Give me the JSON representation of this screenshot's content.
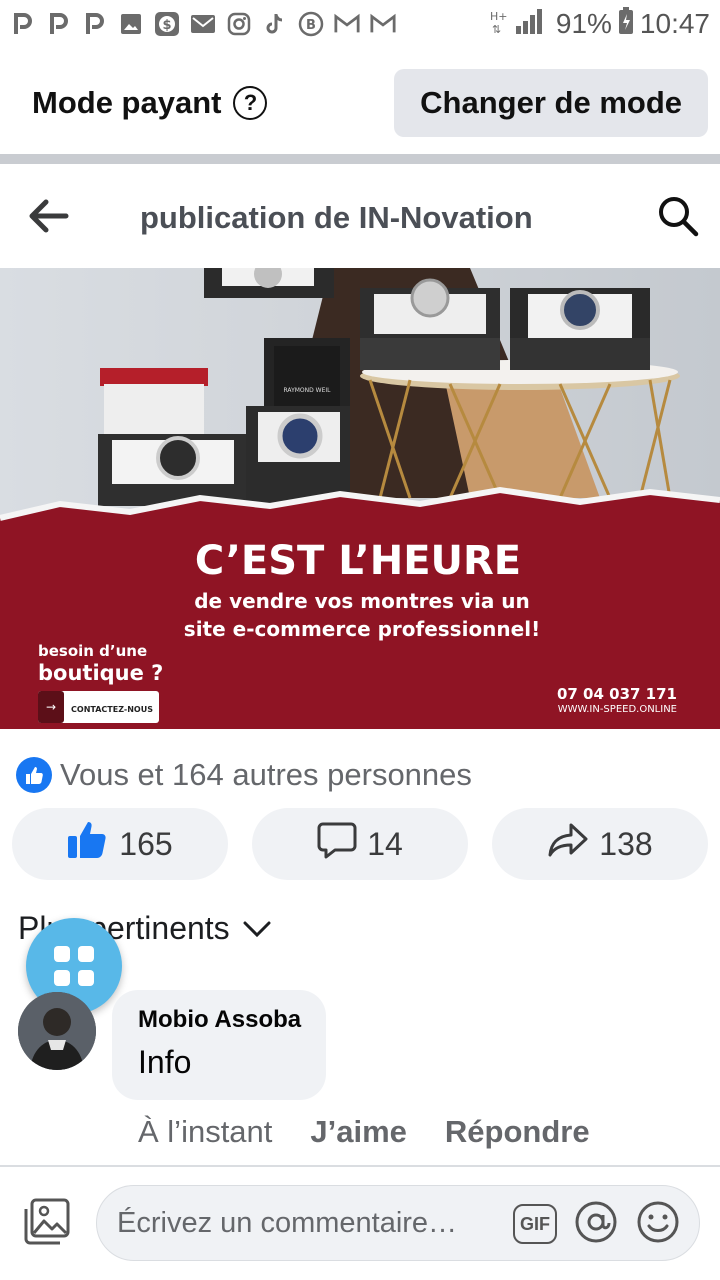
{
  "status_bar": {
    "left_icons": [
      "p-icon",
      "p-icon",
      "p-icon",
      "image-icon",
      "dollar-box-icon",
      "mail-icon",
      "instagram-icon",
      "tiktok-icon",
      "b-circle-icon",
      "gmail-icon",
      "gmail-icon"
    ],
    "battery": "91%",
    "time": "10:47"
  },
  "mode_bar": {
    "title": "Mode payant",
    "help_glyph": "?",
    "switch_button": "Changer de mode"
  },
  "header": {
    "title": "publication de IN-Novation"
  },
  "banner": {
    "watch_brand": "RAYMOND WEIL",
    "headline": "C’EST L’HEURE",
    "subline_1": "de vendre vos montres via un",
    "subline_2": "site e-commerce professionnel!",
    "aside_small": "besoin d’une",
    "aside_big": "boutique ?",
    "cta_arrow": "→",
    "cta": "CONTACTEZ-NOUS",
    "phone": "07 04 037 171",
    "website": "WWW.IN-SPEED.ONLINE",
    "colors": {
      "red": "#8f1424",
      "tabletop": "#ffffff"
    }
  },
  "reactions": {
    "summary": "Vous et 164 autres personnes",
    "like_count": "165",
    "comment_count": "14",
    "share_count": "138",
    "accent": "#1877f2"
  },
  "comments": {
    "sort_label": "Plus pertinents",
    "items": [
      {
        "author": "Mobio Assoba",
        "text": "Info",
        "time": "À l’instant",
        "like_action": "J’aime",
        "reply_action": "Répondre"
      }
    ]
  },
  "composer": {
    "placeholder": "Écrivez un commentaire…",
    "gif_label": "GIF"
  }
}
